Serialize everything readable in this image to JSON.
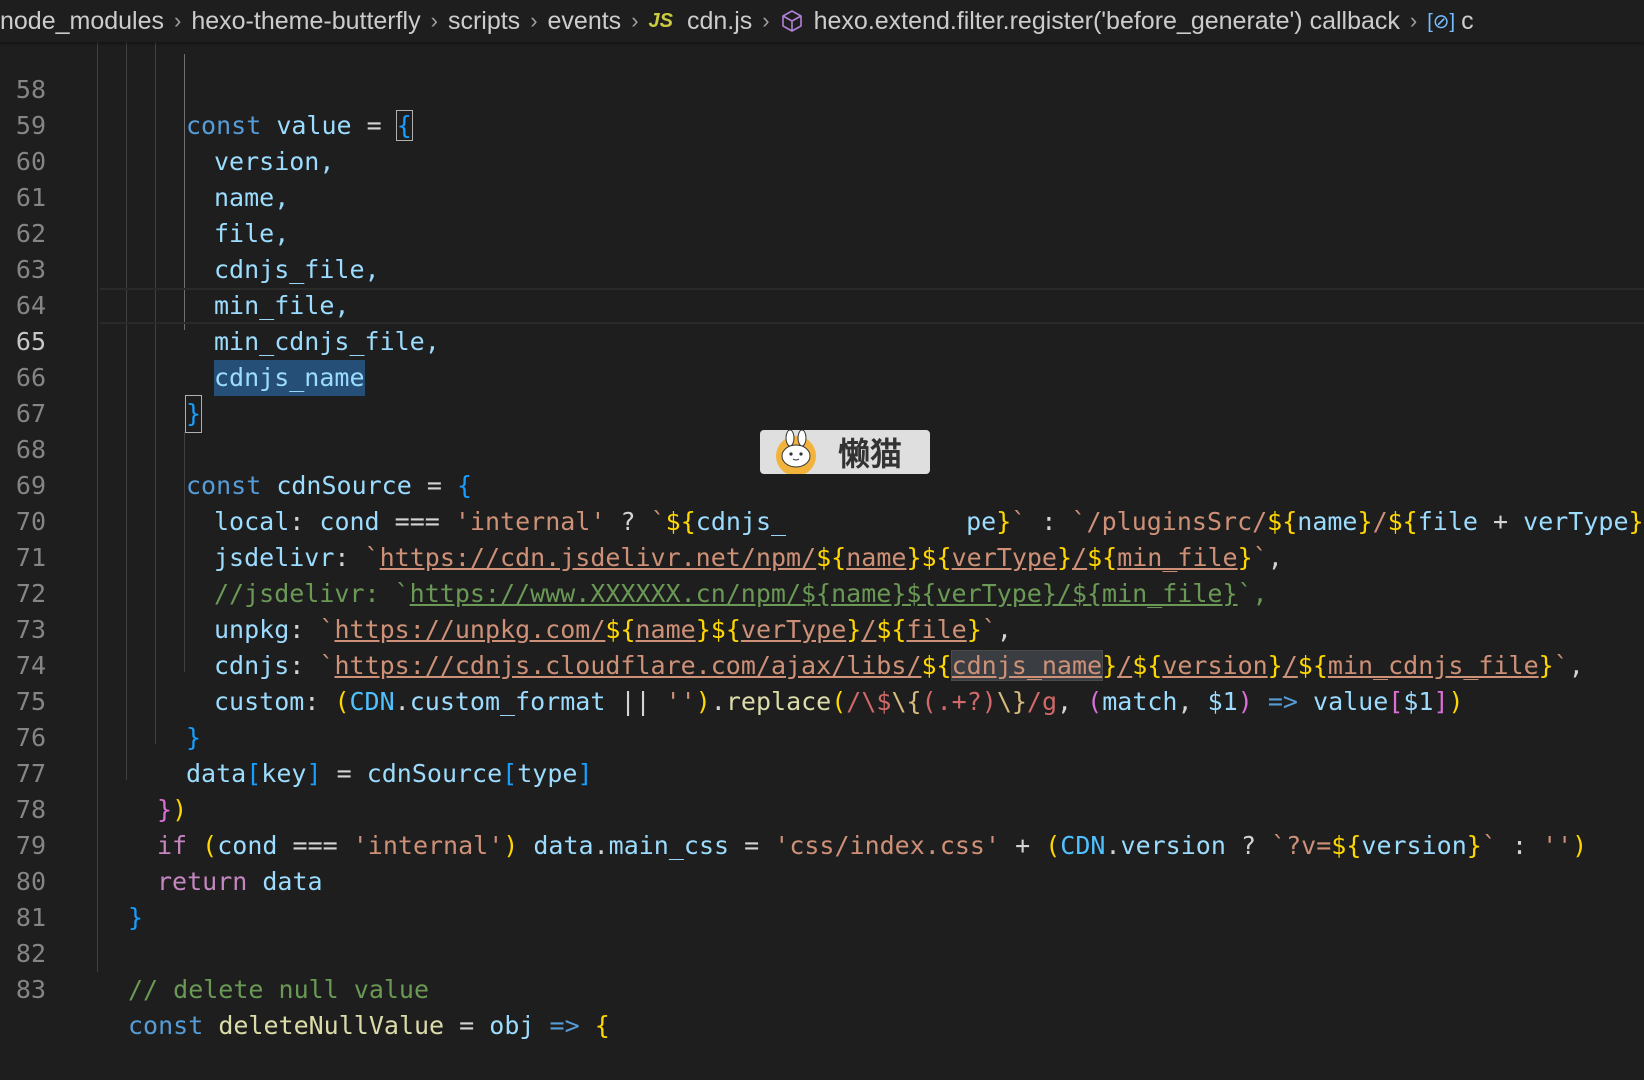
{
  "breadcrumb": {
    "items": [
      "node_modules",
      "hexo-theme-butterfly",
      "scripts",
      "events"
    ],
    "file_icon": "JS",
    "file": "cdn.js",
    "symbol_icon": "cube-icon",
    "symbol": "hexo.extend.filter.register('before_generate') callback",
    "ref_icon": "reference-icon",
    "ref_icon_glyph": "[⊘]",
    "trailing": "c"
  },
  "editor": {
    "current_line": 65,
    "selection": "cdnjs_name",
    "line_numbers": [
      "58",
      "59",
      "60",
      "61",
      "62",
      "63",
      "64",
      "65",
      "66",
      "67",
      "68",
      "69",
      "70",
      "71",
      "72",
      "73",
      "74",
      "75",
      "76",
      "77",
      "78",
      "79",
      "80",
      "81",
      "82",
      "83"
    ],
    "lines": {
      "l58": {
        "a": "const",
        "b": "value",
        "c": "=",
        "d": "{"
      },
      "l59": "version,",
      "l60": "name,",
      "l61": "file,",
      "l62": "cdnjs_file,",
      "l63": "min_file,",
      "l64": "min_cdnjs_file,",
      "l65": "cdnjs_name",
      "l66": "}",
      "l68": {
        "a": "const",
        "b": "cdnSource",
        "c": "=",
        "d": "{"
      },
      "l69": {
        "key": "local",
        "colon": ":",
        "cond": "cond",
        "op": "===",
        "s1": "'internal'",
        "q": "?",
        "t1a": "`",
        "d1": "${",
        "v1": "cdnjs_",
        "hidden": "",
        "v1b": "pe",
        "d1e": "}",
        "t1b": "`",
        "colon2": ":",
        "t2a": "`/pluginsSrc/",
        "d2": "${",
        "v2": "name",
        "d2e": "}",
        "t2b": "/",
        "d3": "${",
        "v3": "file",
        "plus": "+",
        "v4": "verType",
        "d3e": "}",
        "t2c": "`",
        "comma": ","
      },
      "l70": {
        "key": "jsdelivr",
        "colon": ":",
        "tick": "`",
        "url": "https://cdn.jsdelivr.net/npm/",
        "d1": "${",
        "v1": "name",
        "d1e": "}",
        "d2": "${",
        "v2": "verType",
        "d2e": "}",
        "slash": "/",
        "d3": "${",
        "v3": "min_file",
        "d3e": "}",
        "tick2": "`",
        "comma": ","
      },
      "l71": {
        "pre": "//jsdelivr: `",
        "url": "https://www.XXXXXX.cn/npm/${name}${verType}/${min_file}",
        "post": "`,"
      },
      "l72": {
        "key": "unpkg",
        "colon": ":",
        "tick": "`",
        "url": "https://unpkg.com/",
        "d1": "${",
        "v1": "name",
        "d1e": "}",
        "d2": "${",
        "v2": "verType",
        "d2e": "}",
        "slash": "/",
        "d3": "${",
        "v3": "file",
        "d3e": "}",
        "tick2": "`",
        "comma": ","
      },
      "l73": {
        "key": "cdnjs",
        "colon": ":",
        "tick": "`",
        "url": "https://cdnjs.cloudflare.com/ajax/libs/",
        "d1": "${",
        "v1": "cdnjs_name",
        "d1e": "}",
        "slash": "/",
        "d2": "${",
        "v2": "version",
        "d2e": "}",
        "slash2": "/",
        "d3": "${",
        "v3": "min_cdnjs_file",
        "d3e": "}",
        "tick2": "`",
        "comma": ","
      },
      "l74": {
        "key": "custom",
        "colon": ":",
        "p1": "(",
        "obj": "CDN",
        "dot": ".",
        "prop": "custom_format",
        "or": "||",
        "empty": "''",
        "p1e": ")",
        "dot2": ".",
        "fn": "replace",
        "p2": "(",
        "rgx_a": "/\\$",
        "rgx_b": "\\{",
        "rgx_c": "(.+?)",
        "rgx_d": "\\}",
        "rgx_e": "/g",
        "comma": ",",
        "p3": "(",
        "arg1": "match",
        "comma2": ",",
        "arg2": "$1",
        "p3e": ")",
        "arrow": "=>",
        "val": "value",
        "b1": "[",
        "idx": "$1",
        "b1e": "]",
        "p2e": ")"
      },
      "l75": "}",
      "l76": {
        "a": "data",
        "b": "[",
        "c": "key",
        "d": "]",
        "e": "=",
        "f": "cdnSource",
        "g": "[",
        "h": "type",
        "i": "]"
      },
      "l77": {
        "a": "}",
        "b": ")"
      },
      "l78": {
        "kw": "if",
        "p1": "(",
        "cond": "cond",
        "op": "===",
        "s1": "'internal'",
        "p1e": ")",
        "obj": "data",
        "dot": ".",
        "prop": "main_css",
        "eq": "=",
        "s2": "'css/index.css'",
        "plus": "+",
        "p2": "(",
        "cdn": "CDN",
        "dot2": ".",
        "ver": "version",
        "q": "?",
        "t1": "`?v=",
        "d1": "${",
        "v1": "version",
        "d1e": "}",
        "t1e": "`",
        "colon": ":",
        "empty": "''",
        "p2e": ")"
      },
      "l79": {
        "a": "return",
        "b": "data"
      },
      "l80": "}",
      "l82": "// delete null value",
      "l83": {
        "a": "const",
        "b": "deleteNullValue",
        "c": "=",
        "d": "obj",
        "e": "=>",
        "f": "{"
      }
    }
  },
  "watermark": {
    "text": "懒猫",
    "icon": "rabbit-mascot-icon"
  }
}
